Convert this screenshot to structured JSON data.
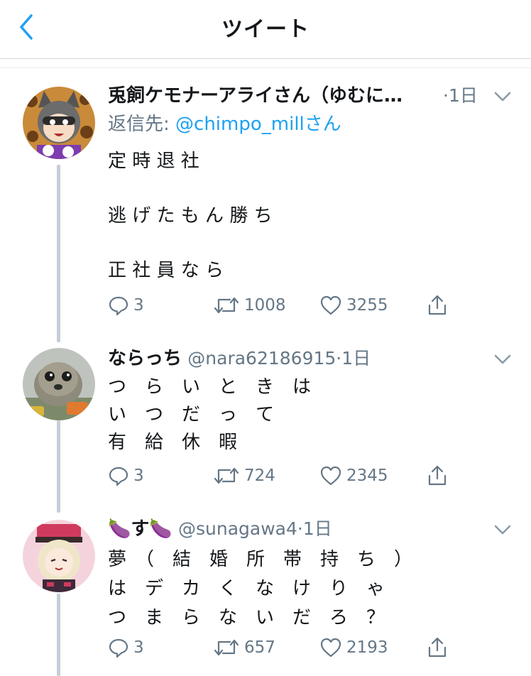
{
  "header": {
    "title": "ツイート"
  },
  "tweets": [
    {
      "display_name": "兎飼ケモナーアライさん（ゆむに…",
      "handle": "",
      "time": "·1日",
      "reply_prefix": "返信先: ",
      "reply_to": "@chimpo_millさん",
      "text": "定 時 退 社\n\n逃 げ た も ん 勝 ち\n\n正 社 員 な ら",
      "replies": "3",
      "retweets": "1008",
      "likes": "3255"
    },
    {
      "display_name": "ならっち",
      "handle": "@nara62186915",
      "time": "·1日",
      "text": "つ　ら　い　と　き　は\nい　つ　だ　っ　て\n有　給　休　暇",
      "replies": "3",
      "retweets": "724",
      "likes": "2345"
    },
    {
      "display_name": "🍆す🍆",
      "handle": "@sunagawa4",
      "time": "·1日",
      "text": "夢　（　結　婚　所　帯　持　ち　）\nは　デ　カ　く　な　け　り　ゃ\nつ　ま　ら　な　い　だ　ろ　？",
      "replies": "3",
      "retweets": "657",
      "likes": "2193"
    }
  ],
  "colors": {
    "accent": "#1da1f2",
    "secondary_text": "#657786",
    "thread_line": "#c4ced8"
  }
}
